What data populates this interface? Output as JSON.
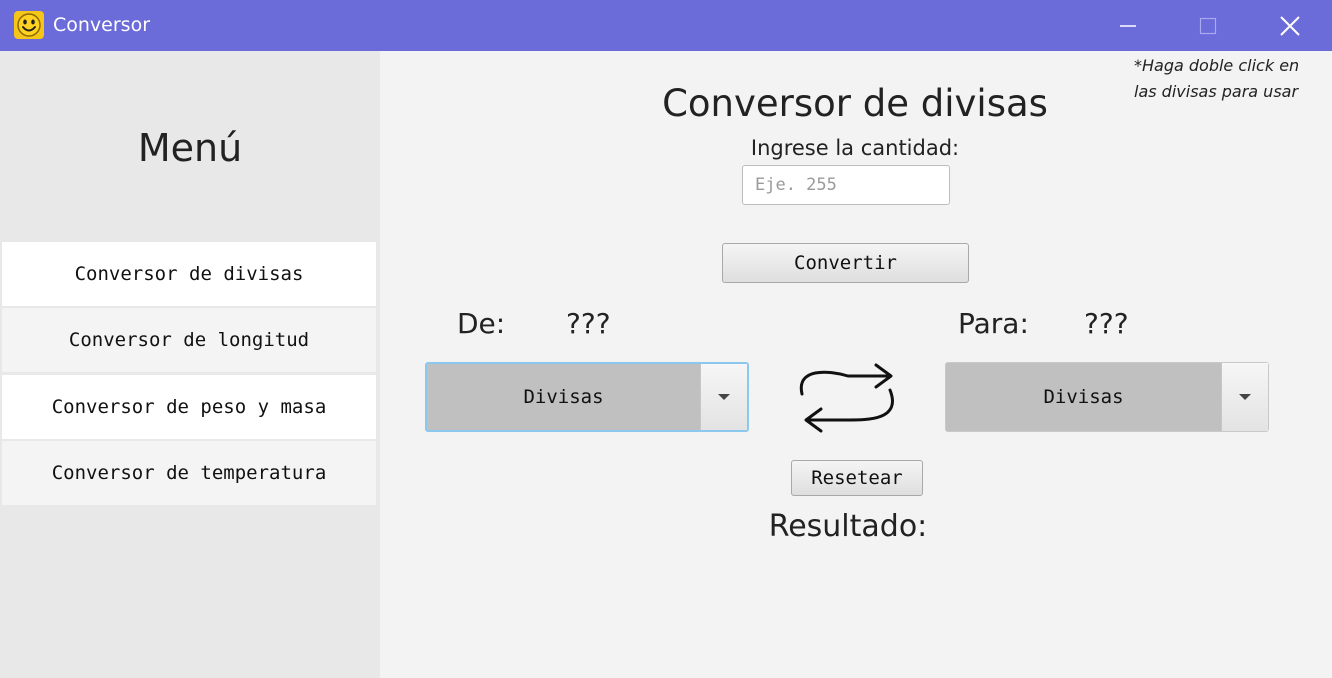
{
  "window": {
    "title": "Conversor",
    "app_icon": "smiley-icon",
    "controls": [
      "minimize-icon",
      "maximize-icon",
      "close-icon"
    ],
    "title_bar_color": "#6b6bd9"
  },
  "sidebar": {
    "title": "Menú",
    "items": [
      {
        "label": "Conversor de divisas"
      },
      {
        "label": "Conversor de longitud"
      },
      {
        "label": "Conversor de peso y masa"
      },
      {
        "label": "Conversor de temperatura"
      }
    ]
  },
  "main": {
    "hint_line1": "*Haga doble click en",
    "hint_line2": "las divisas para usar",
    "title": "Conversor de divisas",
    "amount_label": "Ingrese la cantidad:",
    "amount_value": "",
    "amount_placeholder": "Eje. 255",
    "convert_label": "Convertir",
    "from_label": "De:",
    "from_value": "???",
    "to_label": "Para:",
    "to_value": "???",
    "from_select": "Divisas",
    "to_select": "Divisas",
    "swap_icon": "swap-arrows-icon",
    "reset_label": "Resetear",
    "result_label": "Resultado:"
  }
}
